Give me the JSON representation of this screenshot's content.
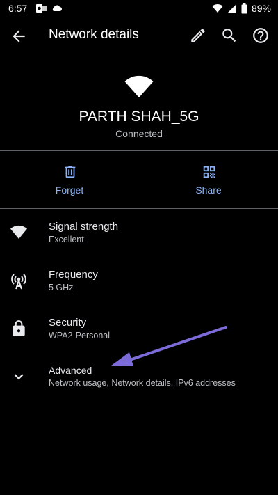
{
  "status_bar": {
    "time": "6:57",
    "battery": "89%"
  },
  "app_bar": {
    "title": "Network details"
  },
  "network": {
    "name": "PARTH SHAH_5G",
    "status": "Connected"
  },
  "actions": {
    "forget_label": "Forget",
    "share_label": "Share"
  },
  "details": {
    "signal": {
      "title": "Signal strength",
      "value": "Excellent"
    },
    "frequency": {
      "title": "Frequency",
      "value": "5 GHz"
    },
    "security": {
      "title": "Security",
      "value": "WPA2-Personal"
    },
    "advanced": {
      "title": "Advanced",
      "value": "Network usage, Network details, IPv6 addresses"
    }
  },
  "colors": {
    "background": "#000000",
    "accent": "#8ab4f8",
    "annotation_arrow": "#7b6cd9",
    "divider": "#5f6368"
  }
}
